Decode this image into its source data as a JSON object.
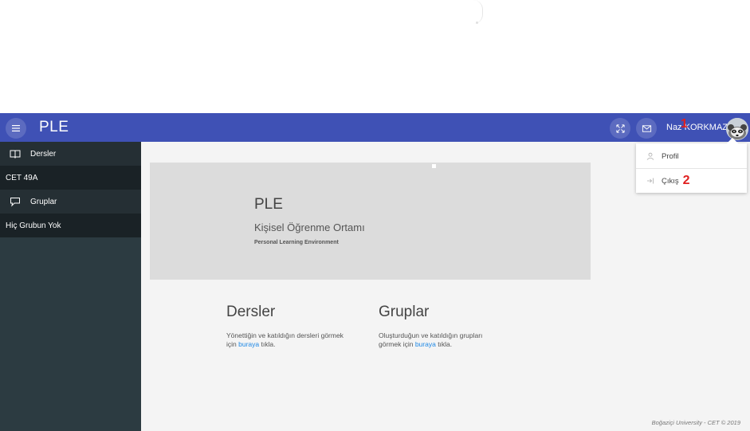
{
  "app": {
    "title": "PLE"
  },
  "header": {
    "user_name": "Naz KORKMAZ",
    "icons": [
      "expand-icon",
      "mail-icon",
      "menu-icon"
    ]
  },
  "sidebar": {
    "items": [
      {
        "label": "Dersler",
        "icon": "book-icon"
      },
      {
        "label": "CET 49A"
      },
      {
        "label": "Gruplar",
        "icon": "chat-icon"
      },
      {
        "label": "Hiç Grubun Yok"
      }
    ]
  },
  "banner": {
    "title": "PLE",
    "subtitle": "Kişisel Öğrenme Ortamı",
    "subtitle_en": "Personal Learning Environment"
  },
  "cards": [
    {
      "title": "Dersler",
      "text_line1": "Yönettiğin ve katıldığın dersleri görmek",
      "text_pre": "için ",
      "link": "buraya",
      "text_post": " tıkla."
    },
    {
      "title": "Gruplar",
      "text_line1": "Oluşturduğun ve katıldığın grupları",
      "text_pre": "görmek için ",
      "link": "buraya",
      "text_post": " tıkla."
    }
  ],
  "dropdown": {
    "items": [
      {
        "label": "Profil",
        "icon": "user-icon"
      },
      {
        "label": "Çıkış",
        "icon": "logout-icon"
      }
    ]
  },
  "annotations": {
    "first": "1",
    "second": "2"
  },
  "footer": {
    "text": "Boğaziçi University - CET © 2019"
  },
  "colors": {
    "topbar": "#3f51b5",
    "sidebar": "#2c3b41",
    "link": "#1e88e5",
    "annotation": "#e02020"
  }
}
